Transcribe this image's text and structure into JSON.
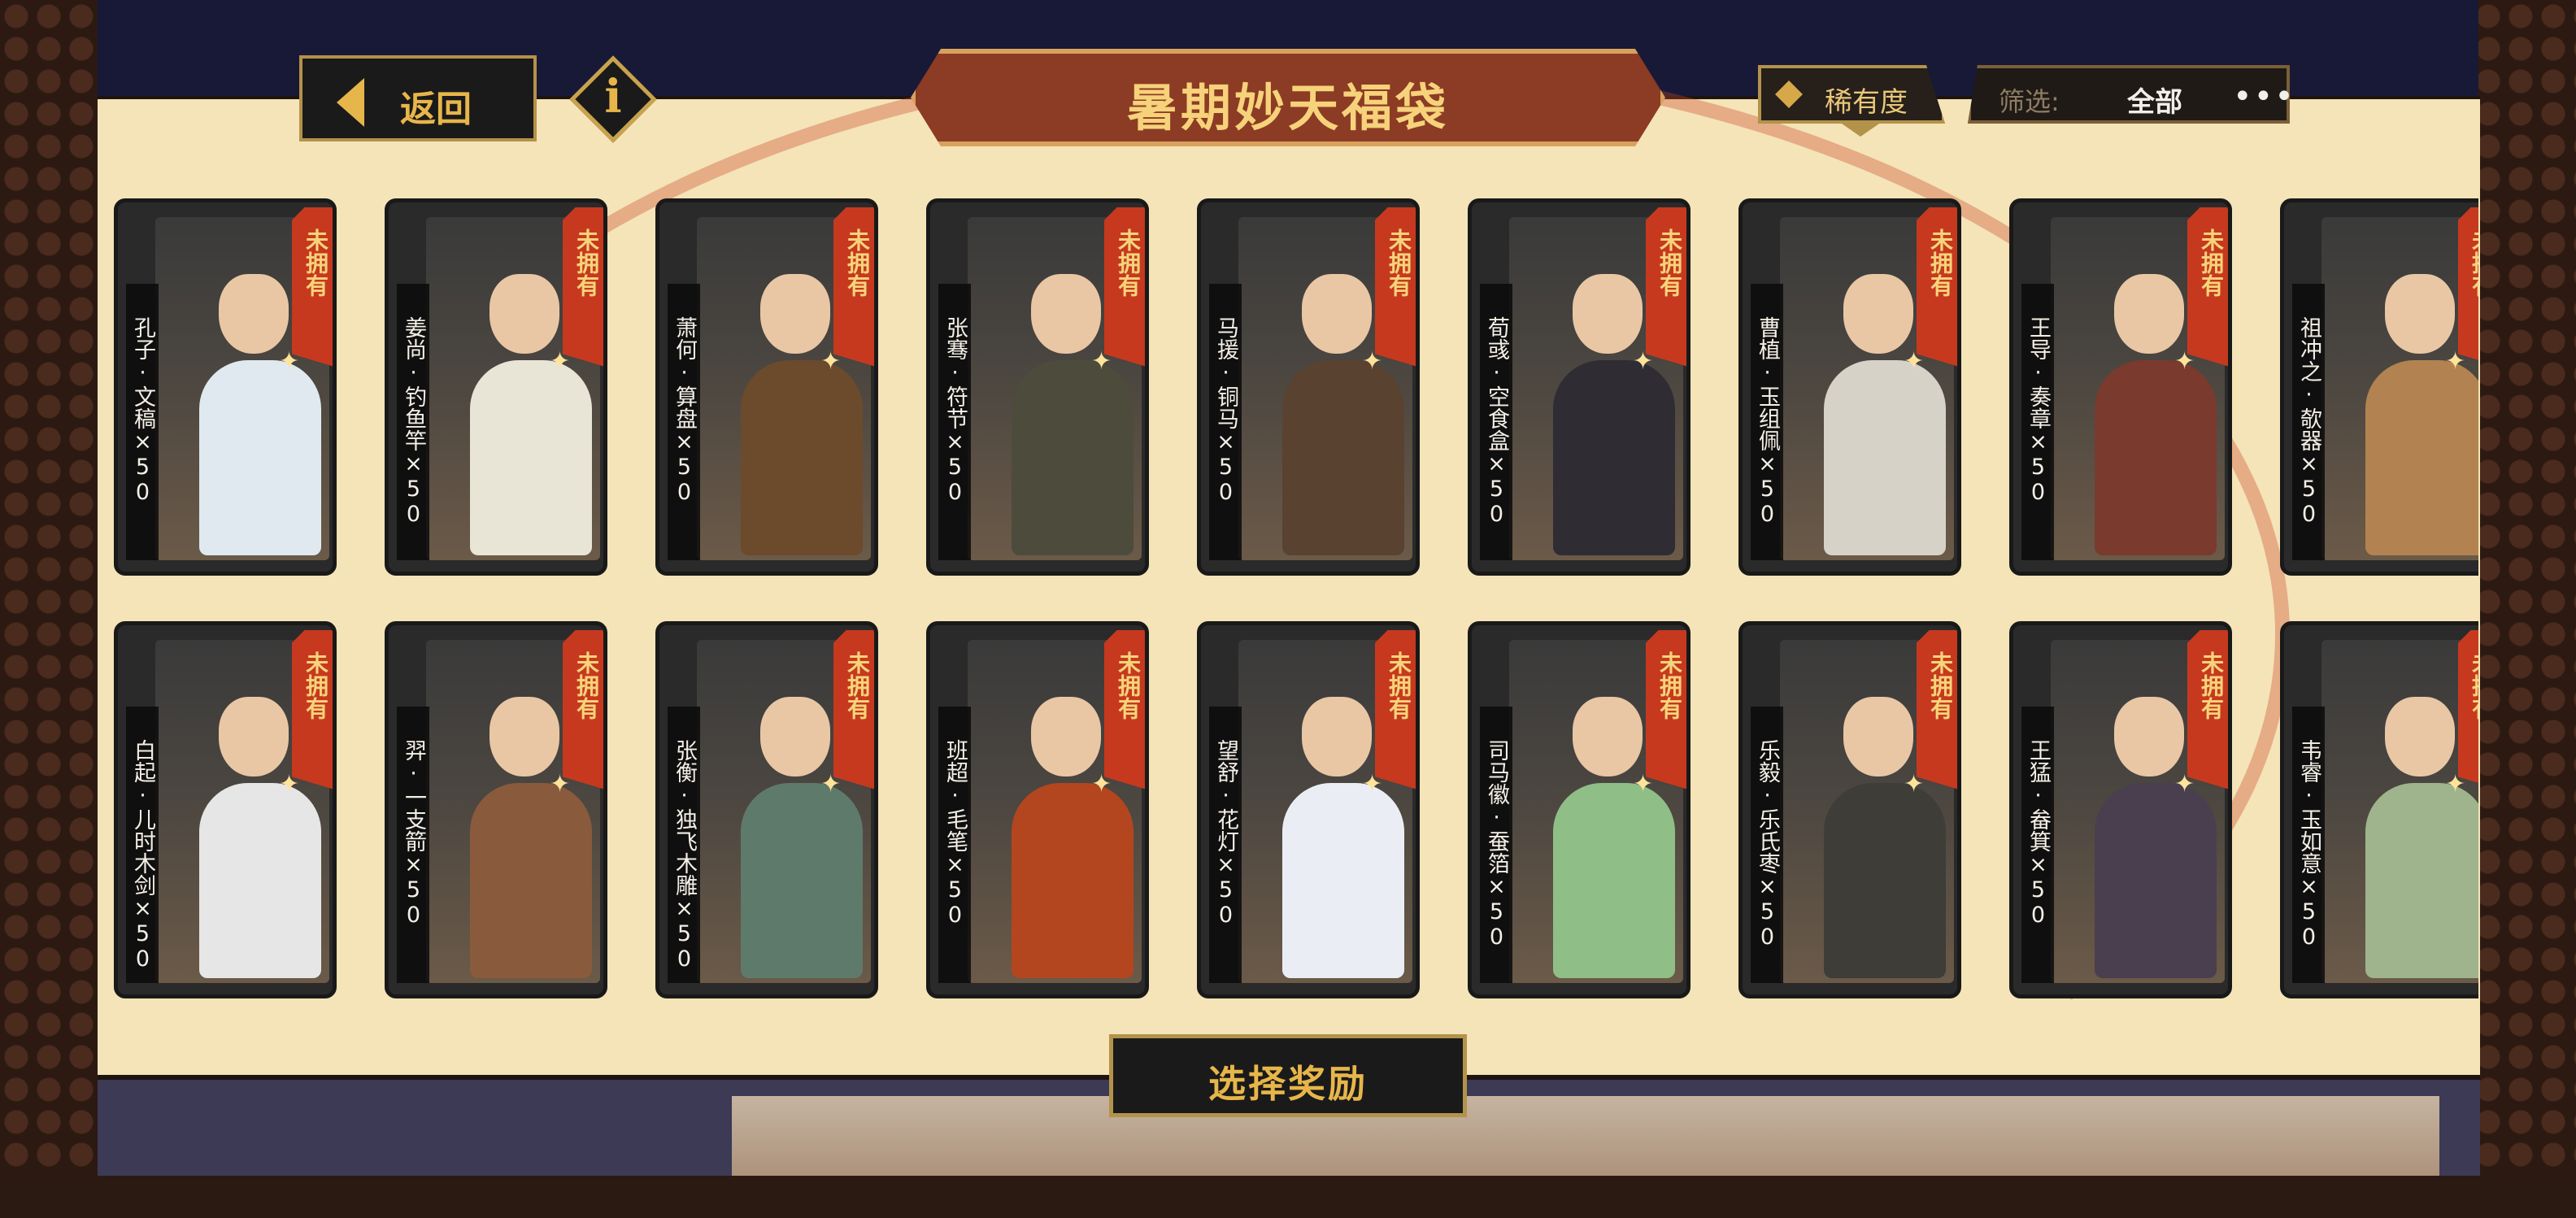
{
  "header": {
    "back_label": "返回",
    "info_icon": "info-icon",
    "title": "暑期妙天福袋",
    "rarity_label": "稀有度",
    "filter_label": "筛选:",
    "filter_value": "全部",
    "more_label": "•••"
  },
  "status_badge": "未拥有",
  "cards_row1": [
    {
      "name": "孔子·文稿×50",
      "robe": "#dfe9ef"
    },
    {
      "name": "姜尚·钓鱼竿×50",
      "robe": "#e8e4d6"
    },
    {
      "name": "萧何·算盘×50",
      "robe": "#6c4a2c"
    },
    {
      "name": "张骞·符节×50",
      "robe": "#4d4b3c"
    },
    {
      "name": "马援·铜马×50",
      "robe": "#5a4230"
    },
    {
      "name": "荀彧·空食盒×50",
      "robe": "#2f2c33"
    },
    {
      "name": "曹植·玉组佩×50",
      "robe": "#d7d2c8"
    },
    {
      "name": "王导·奏章×50",
      "robe": "#7a3a2e"
    },
    {
      "name": "祖冲之·欹器×50",
      "robe": "#b28350"
    }
  ],
  "cards_row2": [
    {
      "name": "白起·儿时木剑×50",
      "robe": "#e6e6e6"
    },
    {
      "name": "羿·一支箭×50",
      "robe": "#8a5a3c"
    },
    {
      "name": "张衡·独飞木雕×50",
      "robe": "#5e7a6a"
    },
    {
      "name": "班超·毛笔×50",
      "robe": "#b3461f"
    },
    {
      "name": "望舒·花灯×50",
      "robe": "#eaeef4"
    },
    {
      "name": "司马徽·蚕箔×50",
      "robe": "#8fbf86"
    },
    {
      "name": "乐毅·乐氏枣×50",
      "robe": "#3e3d38"
    },
    {
      "name": "王猛·畚箕×50",
      "robe": "#4a3f4e"
    },
    {
      "name": "韦睿·玉如意×50",
      "robe": "#9fb48c"
    }
  ],
  "footer": {
    "select_label": "选择奖励"
  }
}
